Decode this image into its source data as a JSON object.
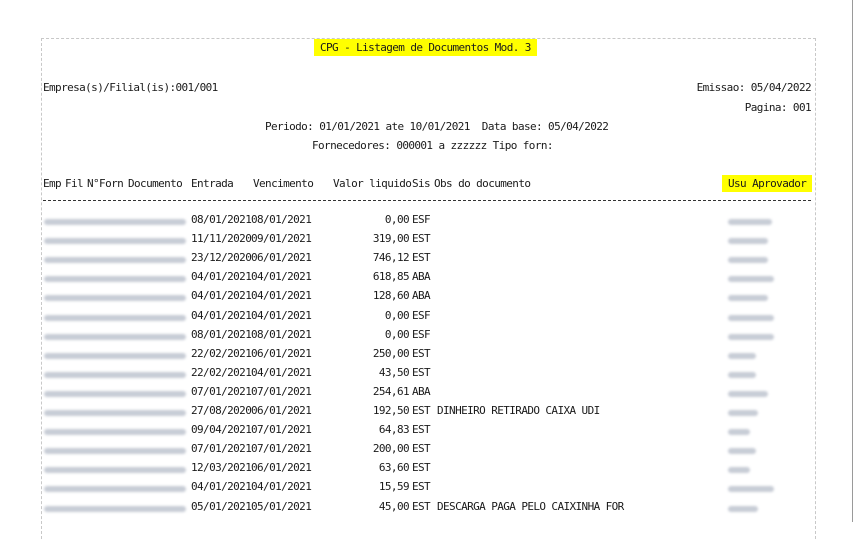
{
  "report": {
    "title": "CPG - Listagem de Documentos Mod. 3",
    "empresa": "Empresa(s)/Filial(is):001/001",
    "emissao": "Emissao: 05/04/2022",
    "pagina": "Pagina: 001",
    "periodo": "Periodo: 01/01/2021 ate 10/01/2021  Data base: 05/04/2022",
    "fornecedores": "Fornecedores: 000001 a zzzzzz Tipo forn:"
  },
  "columns": {
    "emp": "Emp",
    "fil": "Fil",
    "forn": "N°Forn",
    "documento": "Documento",
    "entrada": "Entrada",
    "vencimento": "Vencimento",
    "valor": "Valor liquido",
    "sis": "Sis",
    "obs": "Obs do documento",
    "usu": "Usu Aprovador"
  },
  "rows": [
    {
      "entrada": "08/01/2021",
      "vencimento": "08/01/2021",
      "valor": "0,00",
      "sis": "ESF",
      "obs": ""
    },
    {
      "entrada": "11/11/2020",
      "vencimento": "09/01/2021",
      "valor": "319,00",
      "sis": "EST",
      "obs": ""
    },
    {
      "entrada": "23/12/2020",
      "vencimento": "06/01/2021",
      "valor": "746,12",
      "sis": "EST",
      "obs": ""
    },
    {
      "entrada": "04/01/2021",
      "vencimento": "04/01/2021",
      "valor": "618,85",
      "sis": "ABA",
      "obs": ""
    },
    {
      "entrada": "04/01/2021",
      "vencimento": "04/01/2021",
      "valor": "128,60",
      "sis": "ABA",
      "obs": ""
    },
    {
      "entrada": "04/01/2021",
      "vencimento": "04/01/2021",
      "valor": "0,00",
      "sis": "ESF",
      "obs": ""
    },
    {
      "entrada": "08/01/2021",
      "vencimento": "08/01/2021",
      "valor": "0,00",
      "sis": "ESF",
      "obs": ""
    },
    {
      "entrada": "22/02/2021",
      "vencimento": "06/01/2021",
      "valor": "250,00",
      "sis": "EST",
      "obs": ""
    },
    {
      "entrada": "22/02/2021",
      "vencimento": "04/01/2021",
      "valor": "43,50",
      "sis": "EST",
      "obs": ""
    },
    {
      "entrada": "07/01/2021",
      "vencimento": "07/01/2021",
      "valor": "254,61",
      "sis": "ABA",
      "obs": ""
    },
    {
      "entrada": "27/08/2020",
      "vencimento": "06/01/2021",
      "valor": "192,50",
      "sis": "EST",
      "obs": "DINHEIRO RETIRADO CAIXA UDI"
    },
    {
      "entrada": "09/04/2021",
      "vencimento": "07/01/2021",
      "valor": "64,83",
      "sis": "EST",
      "obs": ""
    },
    {
      "entrada": "07/01/2021",
      "vencimento": "07/01/2021",
      "valor": "200,00",
      "sis": "EST",
      "obs": ""
    },
    {
      "entrada": "12/03/2021",
      "vencimento": "06/01/2021",
      "valor": "63,60",
      "sis": "EST",
      "obs": ""
    },
    {
      "entrada": "04/01/2021",
      "vencimento": "04/01/2021",
      "valor": "15,59",
      "sis": "EST",
      "obs": ""
    },
    {
      "entrada": "05/01/2021",
      "vencimento": "05/01/2021",
      "valor": "45,00",
      "sis": "EST",
      "obs": "DESCARGA PAGA PELO CAIXINHA FOR"
    }
  ],
  "colors": {
    "highlight": "#ffff00",
    "blur": "#9aa3b4"
  }
}
